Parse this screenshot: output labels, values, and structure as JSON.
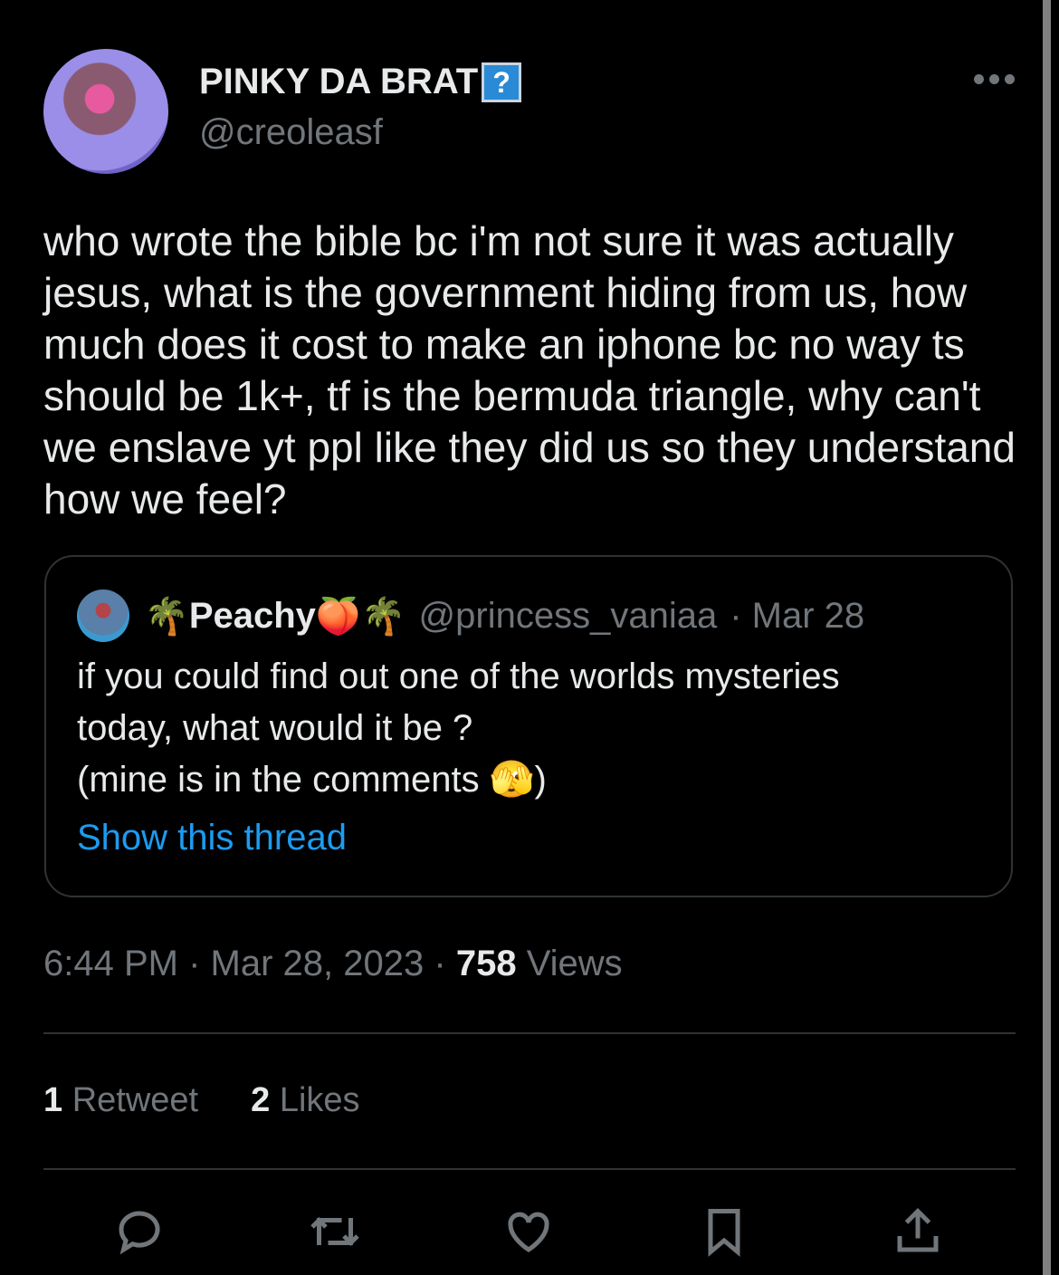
{
  "author": {
    "name": "PINKY DA BRAT",
    "badge": "?",
    "handle": "@creoleasf"
  },
  "tweet": {
    "text": "who wrote the bible bc i'm not sure it was actually jesus, what is the government hiding from us, how much does it cost to make an iphone bc no way ts should be 1k+, tf is the bermuda triangle, why can't we enslave yt ppl like they did us so they understand how we feel?"
  },
  "quote": {
    "name_prefix": "🌴",
    "name": "Peachy",
    "name_suffix": "🍑🌴",
    "handle": "@princess_vaniaa",
    "date": "· Mar 28",
    "lines": [
      "if you could find out one of the worlds mysteries",
      "today, what would it be ?",
      "(mine is in the comments 🫣)"
    ],
    "show_thread": "Show this thread"
  },
  "meta": {
    "time": "6:44 PM",
    "sep1": "·",
    "date": "Mar 28, 2023",
    "sep2": "·",
    "views_count": "758",
    "views_label": "Views"
  },
  "stats": {
    "retweets_count": "1",
    "retweets_label": "Retweet",
    "likes_count": "2",
    "likes_label": "Likes"
  },
  "colors": {
    "background": "#000000",
    "link": "#1d9bf0",
    "secondary_text": "#71767b",
    "border": "#2f3336"
  },
  "icons": [
    "reply-icon",
    "retweet-icon",
    "like-icon",
    "bookmark-icon",
    "share-icon",
    "more-icon"
  ]
}
